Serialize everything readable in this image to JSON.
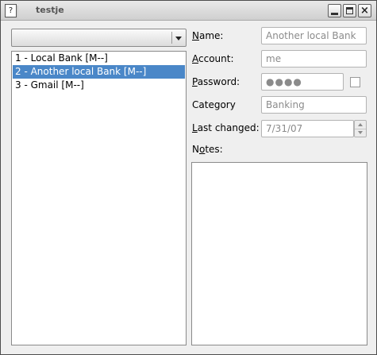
{
  "window": {
    "title": "testje",
    "app_icon": "?"
  },
  "titlebar_buttons": {
    "minimize": "minimize-icon",
    "maximize": "maximize-icon",
    "close": "×"
  },
  "combo": {
    "value": ""
  },
  "list": {
    "items": [
      {
        "label": "1 - Local Bank [M--]",
        "selected": false
      },
      {
        "label": "2 - Another local Bank [M--]",
        "selected": true
      },
      {
        "label": "3 - Gmail [M--]",
        "selected": false
      }
    ]
  },
  "form": {
    "name": {
      "label_u": "N",
      "label_rest": "ame:",
      "value": "Another local Bank"
    },
    "account": {
      "label_u": "A",
      "label_rest": "ccount:",
      "value": "me"
    },
    "password": {
      "label_u": "P",
      "label_rest": "assword:",
      "value": "●●●●"
    },
    "category": {
      "label": "Category",
      "value": "Banking"
    },
    "last_changed": {
      "label_u": "L",
      "label_rest": "ast changed:",
      "value": "7/31/07"
    },
    "notes": {
      "label_pre": "N",
      "label_u": "o",
      "label_rest": "tes:",
      "value": ""
    }
  },
  "colors": {
    "selection": "#4a87c8",
    "window_bg": "#efefef",
    "disabled_text": "#8b8b8b"
  }
}
